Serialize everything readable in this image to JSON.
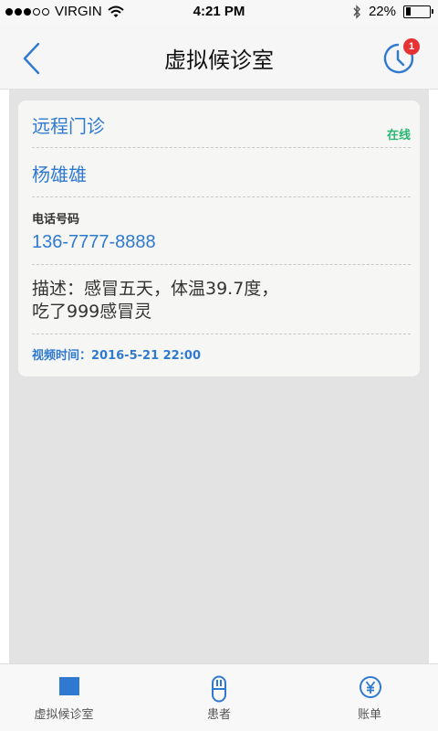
{
  "status_bar": {
    "carrier": "VIRGIN",
    "time": "4:21 PM",
    "battery_percent": "22%",
    "battery_level": 0.22,
    "signal_dots_filled": 3,
    "signal_dots_total": 5
  },
  "nav": {
    "title": "虚拟候诊室",
    "back_icon": "chevron-left-icon",
    "history_icon": "clock-icon",
    "badge_count": "1",
    "accent_color": "#2f7ad0",
    "badge_color": "#e63232"
  },
  "card": {
    "service_type": "远程门诊",
    "status": "在线",
    "patient_name": "杨雄雄",
    "phone_label": "电话号码",
    "phone_value": "136-7777-8888",
    "description_line1": "描述：感冒五天，体温39.7度，",
    "description_line2": "吃了999感冒灵",
    "video_time": "视频时间：2016-5-21 22:00"
  },
  "tabs": [
    {
      "label": "虚拟候诊室",
      "icon": "square-icon",
      "active": true
    },
    {
      "label": "患者",
      "icon": "capsule-icon",
      "active": false
    },
    {
      "label": "账单",
      "icon": "yen-icon",
      "active": false
    }
  ]
}
